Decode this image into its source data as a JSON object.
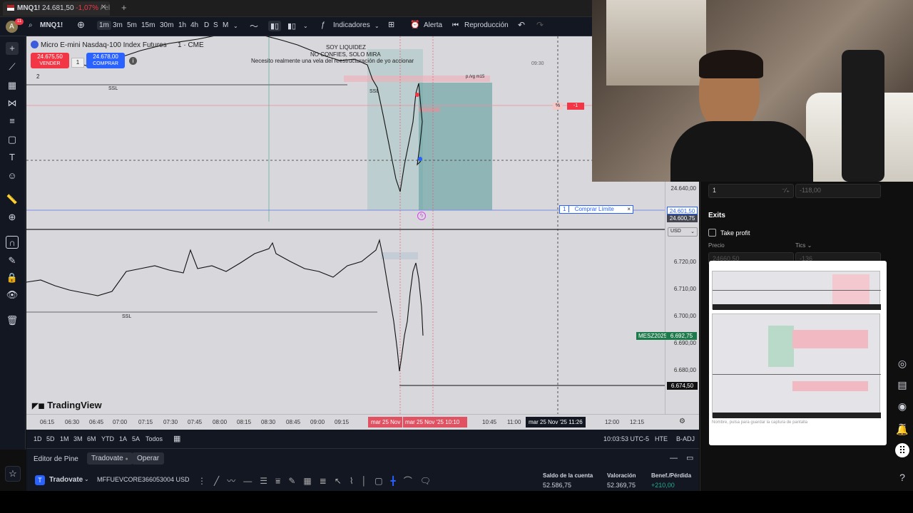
{
  "tab": {
    "symbol": "MNQ1!",
    "price": "24.681,50",
    "change": "-1,07%",
    "suffix": "/ el"
  },
  "toolbar": {
    "avatar_letter": "A",
    "notif_count": "11",
    "symbol": "MNQ1!",
    "intervals": [
      "1m",
      "3m",
      "5m",
      "15m",
      "30m",
      "1h",
      "4h",
      "D",
      "S",
      "M"
    ],
    "selected_interval": "1m",
    "indicators": "Indicadores",
    "alert": "Alerta",
    "replay": "Reproducción"
  },
  "chart": {
    "legend_title": "Micro E-mini Nasdaq-100 Index Futures",
    "legend_suffix": "1 · CME",
    "sell_price": "24.675,50",
    "sell_label": "VENDER",
    "qty": "1",
    "buy_price": "24.678,00",
    "buy_label": "COMPRAR",
    "legend_count": "2",
    "annotation_1": "SOY LIQUIDEZ",
    "annotation_2": "NO CONFIES, SOLO MIRA",
    "annotation_3": "Necesito realmente una vela del reestructuración de yo accionar",
    "ssl_top_left": "SSL",
    "ssl_top_mid": "SSL",
    "ssl_bottom": "SSL",
    "time_label": "09:30",
    "fvg_label": "p./vg m15",
    "pct_badge": "%",
    "neg_badge": "-1",
    "order_qty": "1",
    "order_label": "Comprar Límite",
    "order_close": "×",
    "watermark": "TradingView"
  },
  "price_scale": {
    "top_labels": [
      {
        "text": "24.640,00",
        "bg": ""
      },
      {
        "text": "24.601,50",
        "bg": "#2962ff"
      },
      {
        "text": "24.600,75",
        "bg": "#434651"
      }
    ],
    "currency": "USD",
    "bottom_labels": [
      "6.720,00",
      "6.710,00",
      "6.700,00",
      "6.690,00",
      "6.680,00"
    ],
    "mesz_label": "MESZ2025",
    "mesz_price": "6.692,75",
    "low_price": "6.674,50"
  },
  "time_axis": {
    "ticks": [
      "06:15",
      "06:30",
      "06:45",
      "07:00",
      "07:15",
      "07:30",
      "07:45",
      "08:00",
      "08:15",
      "08:30",
      "08:45",
      "09:00",
      "09:15",
      "10:45",
      "11:00",
      "12:00",
      "12:15"
    ],
    "sel_start": "mar 25 Nov",
    "sel_end": "mar 25 Nov '25   10:10",
    "crosshair_label": "mar 25 Nov '25    11:26"
  },
  "range_bar": {
    "ranges": [
      "1D",
      "5D",
      "1M",
      "3M",
      "6M",
      "YTD",
      "1A",
      "5A",
      "Todos"
    ],
    "clock": "10:03:53 UTC-5",
    "hte": "HTE",
    "badj": "B-ADJ"
  },
  "bottom_panel": {
    "tabs": [
      "Editor de Pine",
      "Tradovate",
      "Operar"
    ],
    "broker": "Tradovate",
    "account": "MFFUEVCORE366053004 USD",
    "balance_label": "Saldo de la cuenta",
    "balance_value": "52.586,75",
    "equity_label": "Valoración",
    "equity_value": "52.369,75",
    "pnl_label": "Benef./Pérdida",
    "pnl_value": "+210,00"
  },
  "order_panel": {
    "qty_value": "1",
    "qty_right": "-118,00",
    "exits_title": "Exits",
    "take_profit": "Take profit",
    "price_label": "Precio",
    "tics_label": "Tics",
    "price_value": "24660,50",
    "tics_value": "-136",
    "popup_footer": "Nombre, pulsa para guardar la captura de pantalla"
  },
  "colors": {
    "sell": "#f23645",
    "buy": "#2962ff",
    "chart_bg": "#d7d7dc",
    "long_zone": "#5fa0a0",
    "green_zone": "#8fc7b8"
  }
}
